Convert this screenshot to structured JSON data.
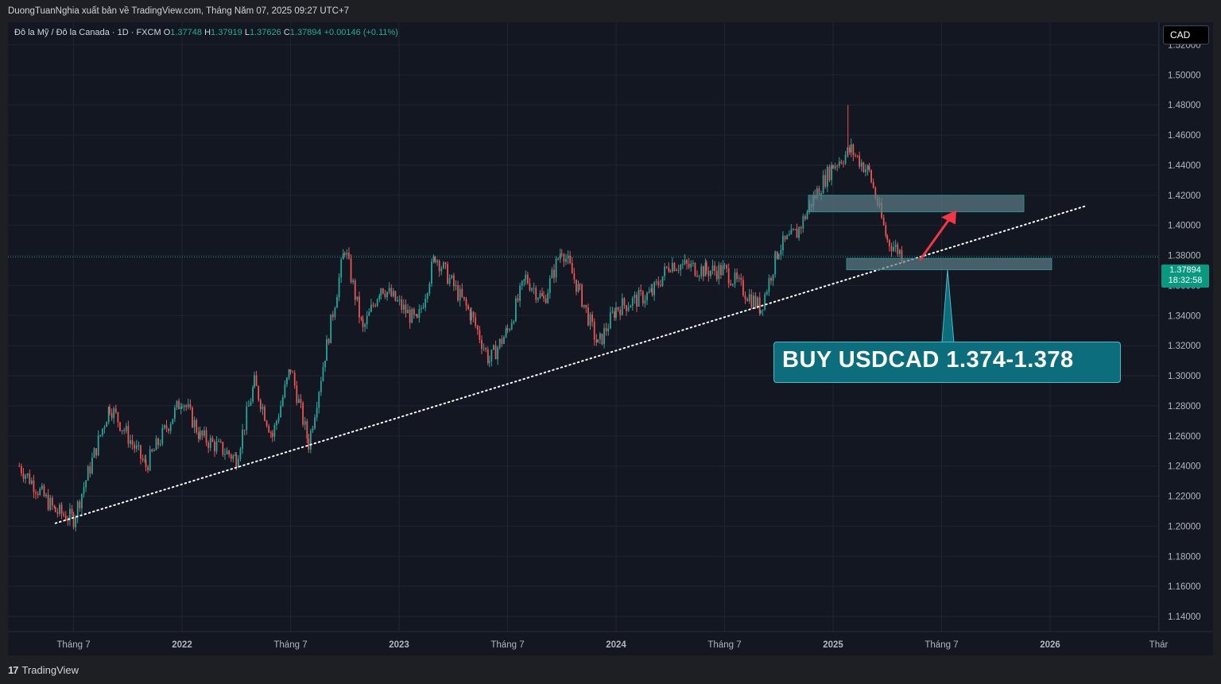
{
  "header": {
    "publisher_line": "DuongTuanNghia xuất bản về TradingView.com, Tháng Năm 07, 2025 09:27 UTC+7"
  },
  "legend": {
    "symbol": "Đô la Mỹ / Đô la Canada · 1D · FXCM",
    "o_label": "O",
    "o": "1.37748",
    "h_label": "H",
    "h": "1.37919",
    "l_label": "L",
    "l": "1.37626",
    "c_label": "C",
    "c": "1.37894",
    "change": "+0.00146 (+0.11%)"
  },
  "currency_button": "CAD",
  "price_tag": {
    "price": "1.37894",
    "countdown": "18:32:58"
  },
  "annotation": {
    "text": "BUY USDCAD 1.374-1.378"
  },
  "footer": {
    "brand": "TradingView"
  },
  "colors": {
    "up": "#26a69a",
    "down": "#ef5350",
    "zone": "#5d7f86",
    "callout": "#0c6e7d",
    "arrow": "#f23645"
  },
  "chart_data": {
    "type": "line",
    "title": "",
    "ylim": [
      1.13,
      1.535
    ],
    "y_ticks": [
      "1.52000",
      "1.50000",
      "1.48000",
      "1.46000",
      "1.44000",
      "1.42000",
      "1.40000",
      "1.38000",
      "1.36000",
      "1.34000",
      "1.32000",
      "1.30000",
      "1.28000",
      "1.26000",
      "1.24000",
      "1.22000",
      "1.20000",
      "1.18000",
      "1.16000",
      "1.14000"
    ],
    "x_ticks": [
      "Tháng 7",
      "2022",
      "Tháng 7",
      "2023",
      "Tháng 7",
      "2024",
      "Tháng 7",
      "2025",
      "Tháng 7",
      "2026",
      "Thár"
    ],
    "grid": true,
    "series": [
      {
        "name": "",
        "x": [
          "2021-04",
          "2021-06",
          "2021-07",
          "2021-09",
          "2021-11",
          "2022-01",
          "2022-02",
          "2022-04",
          "2022-05",
          "2022-06",
          "2022-07",
          "2022-08",
          "2022-09",
          "2022-10",
          "2022-11",
          "2022-12",
          "2023-02",
          "2023-03",
          "2023-05",
          "2023-06",
          "2023-07",
          "2023-08",
          "2023-09",
          "2023-10",
          "2023-11",
          "2023-12",
          "2024-01",
          "2024-03",
          "2024-04",
          "2024-06",
          "2024-07",
          "2024-09",
          "2024-10",
          "2024-11",
          "2024-12",
          "2025-01",
          "2025-02",
          "2025-03",
          "2025-04",
          "2025-05"
        ],
        "values": [
          1.24,
          1.21,
          1.205,
          1.28,
          1.24,
          1.285,
          1.26,
          1.245,
          1.295,
          1.26,
          1.305,
          1.255,
          1.32,
          1.385,
          1.33,
          1.36,
          1.335,
          1.38,
          1.34,
          1.31,
          1.33,
          1.365,
          1.35,
          1.385,
          1.355,
          1.32,
          1.345,
          1.355,
          1.375,
          1.37,
          1.37,
          1.345,
          1.385,
          1.395,
          1.42,
          1.44,
          1.45,
          1.435,
          1.39,
          1.379
        ]
      }
    ],
    "trendline": {
      "from": [
        "2021-06",
        1.202
      ],
      "to": [
        "2026-03",
        1.413
      ]
    },
    "resistance_zone": [
      1.409,
      1.42
    ],
    "support_zone": [
      1.3705,
      1.378
    ],
    "last_price": 1.37894
  }
}
